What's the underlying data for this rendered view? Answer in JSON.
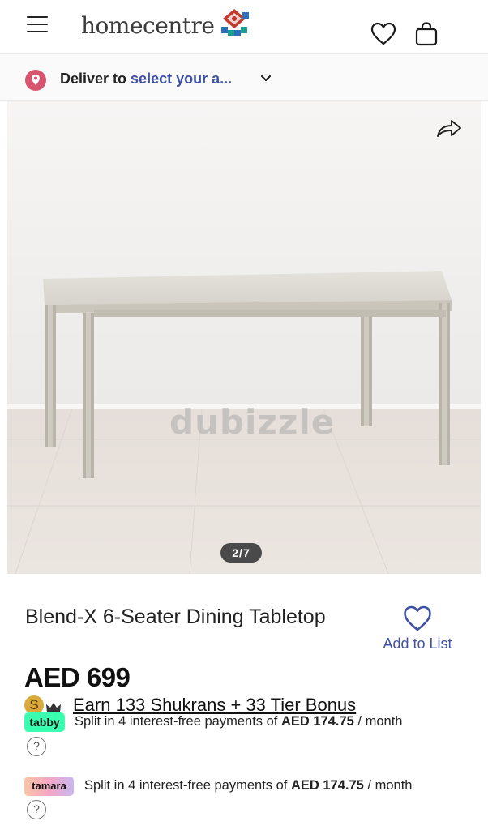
{
  "header": {
    "logo_text": "homecentre",
    "icons": [
      "menu-icon",
      "heart-icon",
      "shopping-bag-icon"
    ]
  },
  "delivery": {
    "prefix": "Deliver to",
    "link": "select your a..."
  },
  "gallery": {
    "counter": "2/7",
    "watermark": "dubizzle"
  },
  "product": {
    "title": "Blend-X 6-Seater Dining Tabletop",
    "wishlist_label": "Add to List",
    "price": "AED 699",
    "shukran_badge": "S",
    "shukran_text": "Earn 133 Shukrans +  33 Tier Bonus"
  },
  "payments": {
    "tabby": {
      "logo": "tabby",
      "text_before": "Split in 4 interest-free payments of ",
      "amount": "AED 174.75",
      "text_after": " / month",
      "help": "?"
    },
    "tamara": {
      "logo": "tamara",
      "text_before": "Split in 4 interest-free payments of ",
      "amount": "AED 174.75",
      "text_after": " / month",
      "help": "?"
    }
  },
  "colors": {
    "accent": "#3f51a6",
    "tabby": "#3bffb0",
    "pin": "#d9546f"
  }
}
